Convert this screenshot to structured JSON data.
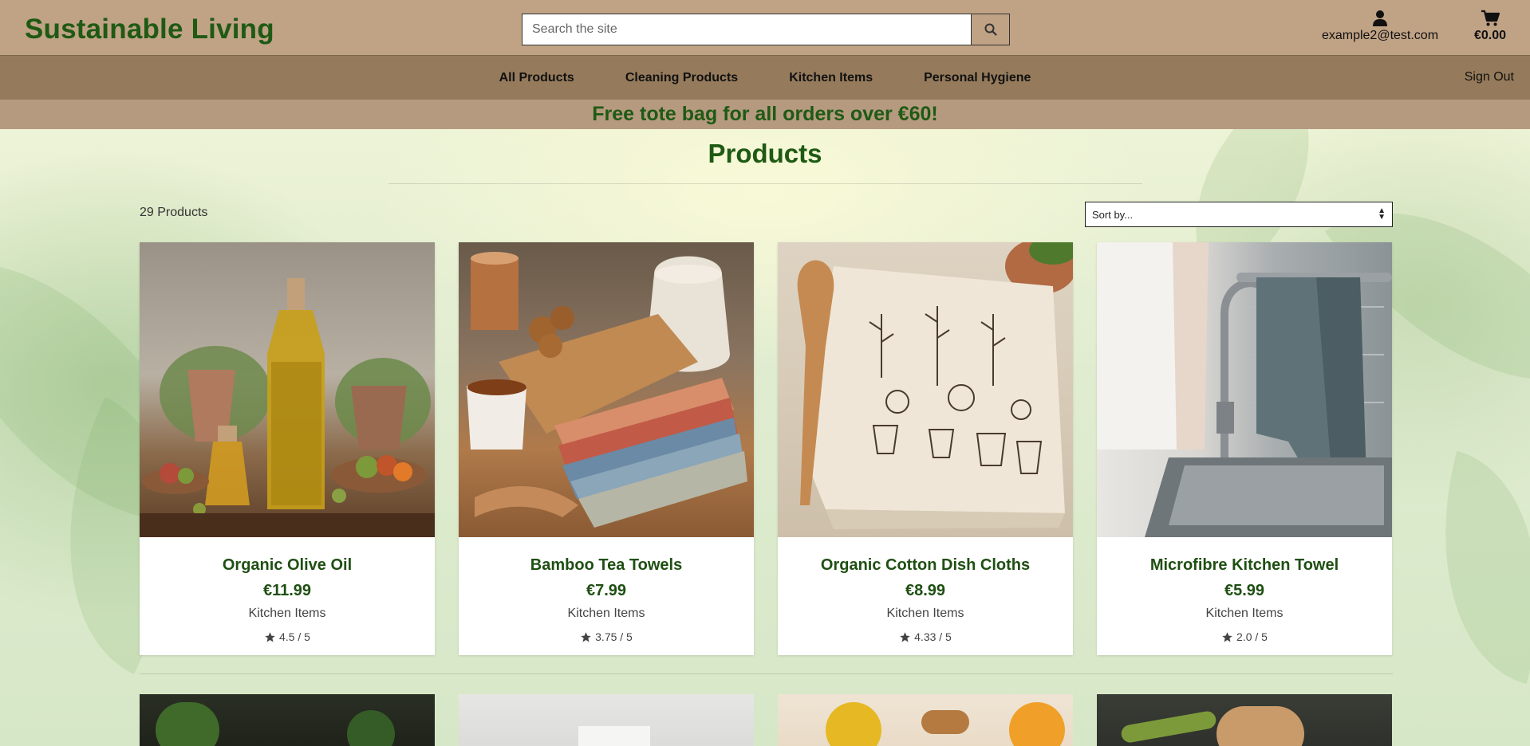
{
  "header": {
    "brand": "Sustainable Living",
    "search_placeholder": "Search the site",
    "search_icon": "search-icon",
    "account_email": "example2@test.com",
    "account_icon": "user-icon",
    "cart_total": "€0.00",
    "cart_icon": "cart-icon"
  },
  "nav": {
    "items": [
      {
        "label": "All Products"
      },
      {
        "label": "Cleaning Products"
      },
      {
        "label": "Kitchen Items"
      },
      {
        "label": "Personal Hygiene"
      }
    ],
    "sign_out": "Sign Out"
  },
  "promo": "Free tote bag for all orders over €60!",
  "main": {
    "title": "Products",
    "count": "29 Products",
    "sort_placeholder": "Sort by..."
  },
  "products": [
    {
      "name": "Organic Olive Oil",
      "price": "€11.99",
      "category": "Kitchen Items",
      "rating": "4.5 / 5"
    },
    {
      "name": "Bamboo Tea Towels",
      "price": "€7.99",
      "category": "Kitchen Items",
      "rating": "3.75 / 5"
    },
    {
      "name": "Organic Cotton Dish Cloths",
      "price": "€8.99",
      "category": "Kitchen Items",
      "rating": "4.33 / 5"
    },
    {
      "name": "Microfibre Kitchen Towel",
      "price": "€5.99",
      "category": "Kitchen Items",
      "rating": "2.0 / 5"
    }
  ],
  "colors": {
    "brand_green": "#1f5a14",
    "header_bg": "#c0a285",
    "nav_bg": "#957b5b",
    "promo_bg": "#b69a80"
  }
}
